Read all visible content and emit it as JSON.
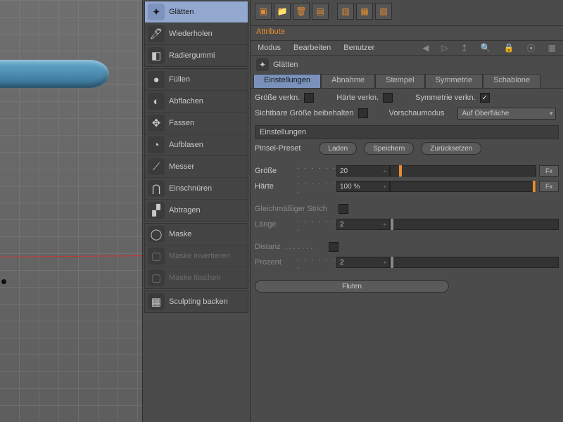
{
  "tools": {
    "group1": [
      {
        "id": "glaetten",
        "label": "Glätten",
        "icon": "✦",
        "selected": true
      },
      {
        "id": "wiederholen",
        "label": "Wiederholen",
        "icon": "🖊"
      },
      {
        "id": "radiergummi",
        "label": "Radiergummi",
        "icon": "◧"
      }
    ],
    "group2": [
      {
        "id": "fuellen",
        "label": "Füllen",
        "icon": "●"
      },
      {
        "id": "abflachen",
        "label": "Abflachen",
        "icon": "◐"
      },
      {
        "id": "fassen",
        "label": "Fassen",
        "icon": "✥"
      },
      {
        "id": "aufblasen",
        "label": "Aufblasen",
        "icon": "◔"
      },
      {
        "id": "messer",
        "label": "Messer",
        "icon": "⟋"
      },
      {
        "id": "einschnueren",
        "label": "Einschnüren",
        "icon": "⋂"
      },
      {
        "id": "abtragen",
        "label": "Abtragen",
        "icon": "▞"
      }
    ],
    "group3": [
      {
        "id": "maske",
        "label": "Maske",
        "icon": "◯"
      },
      {
        "id": "mask-invert",
        "label": "Maske invertieren",
        "icon": "▢",
        "disabled": true
      },
      {
        "id": "mask-loeschen",
        "label": "Maske löschen",
        "icon": "▢",
        "disabled": true
      }
    ],
    "group4": [
      {
        "id": "sculpt-backen",
        "label": "Sculpting backen",
        "icon": "▦"
      }
    ]
  },
  "toolbar_icons": [
    "layer-new",
    "folder-open",
    "trash",
    "layer-x",
    "layer-eye1",
    "layer-eye2",
    "layer-move"
  ],
  "attribute": {
    "tab_label": "Attribute",
    "menu": [
      "Modus",
      "Bearbeiten",
      "Benutzer"
    ],
    "title": "Glätten",
    "sub_tabs": [
      "Einstellungen",
      "Abnahme",
      "Stempel",
      "Symmetrie",
      "Schablone"
    ],
    "row_link": {
      "groesse": "Größe verkn.",
      "haerte": "Härte verkn.",
      "sym": "Symmetrie verkn.",
      "sym_checked": true
    },
    "row_vis": {
      "sichtbare": "Sichtbare Größe beibehalten",
      "vorschau": "Vorschaumodus",
      "vorschau_value": "Auf Oberfläche"
    },
    "section": "Einstellungen",
    "preset": {
      "label": "Pinsel-Preset",
      "laden": "Laden",
      "speichern": "Speichern",
      "reset": "Zurücksetzen"
    },
    "size": {
      "label": "Größe",
      "value": "20",
      "slider_pct": 6,
      "fx": "Fx"
    },
    "hardness": {
      "label": "Härte",
      "value": "100 %",
      "slider_pct": 100,
      "fx": "Fx"
    },
    "even": {
      "label": "Gleichmäßiger Strich"
    },
    "length": {
      "label": "Länge",
      "value": "2"
    },
    "distance": {
      "label": "Distanz"
    },
    "percent": {
      "label": "Prozent",
      "value": "2"
    },
    "flood": "Fluten"
  }
}
